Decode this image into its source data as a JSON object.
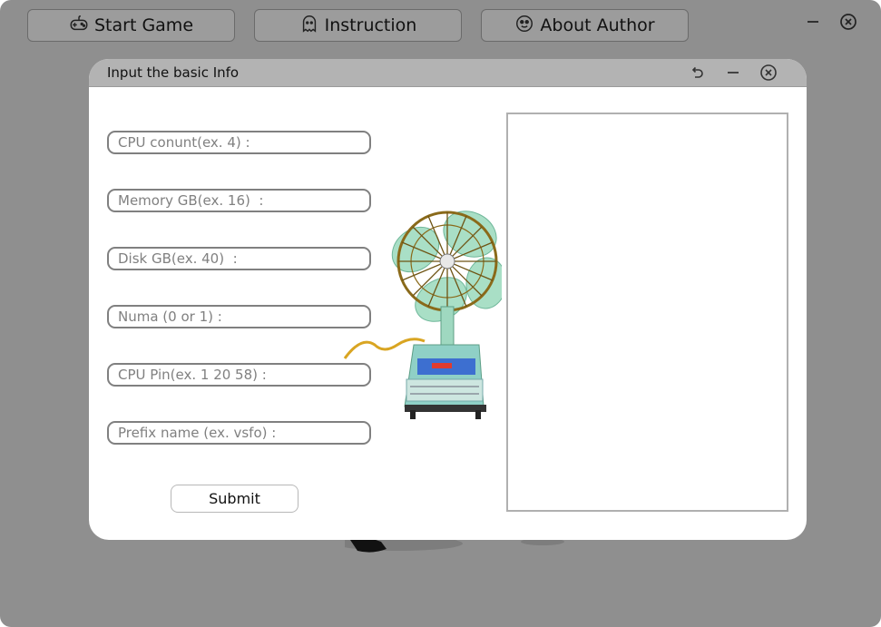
{
  "toolbar": {
    "start_game": {
      "label": "Start Game",
      "icon": "gamepad-icon"
    },
    "instruction": {
      "label": "Instruction",
      "icon": "ghost-icon"
    },
    "about_author": {
      "label": "About Author",
      "icon": "smiley-icon"
    }
  },
  "window_controls": {
    "minimize": "minimize-icon",
    "close": "close-icon"
  },
  "dialog": {
    "title": "Input the basic Info",
    "controls": [
      "undo-icon",
      "minimize-icon",
      "close-icon"
    ],
    "fields": [
      {
        "name": "cpu-count-field",
        "placeholder": "CPU conunt(ex. 4) :",
        "value": ""
      },
      {
        "name": "memory-field",
        "placeholder": "Memory GB(ex. 16)  :",
        "value": ""
      },
      {
        "name": "disk-field",
        "placeholder": "Disk GB(ex. 40)  :",
        "value": ""
      },
      {
        "name": "numa-field",
        "placeholder": "Numa (0 or 1) :",
        "value": ""
      },
      {
        "name": "cpu-pin-field",
        "placeholder": "CPU Pin(ex. 1 20 58) :",
        "value": ""
      },
      {
        "name": "prefix-name-field",
        "placeholder": "Prefix name (ex. vsfo) :",
        "value": ""
      }
    ],
    "submit_label": "Submit",
    "output": ""
  },
  "colors": {
    "app_background": "#8f8f8f",
    "titlebar": "#b3b3b3",
    "field_border": "#808080",
    "fan_blades": "#9fd8c0",
    "fan_cage": "#8a6a1a"
  }
}
